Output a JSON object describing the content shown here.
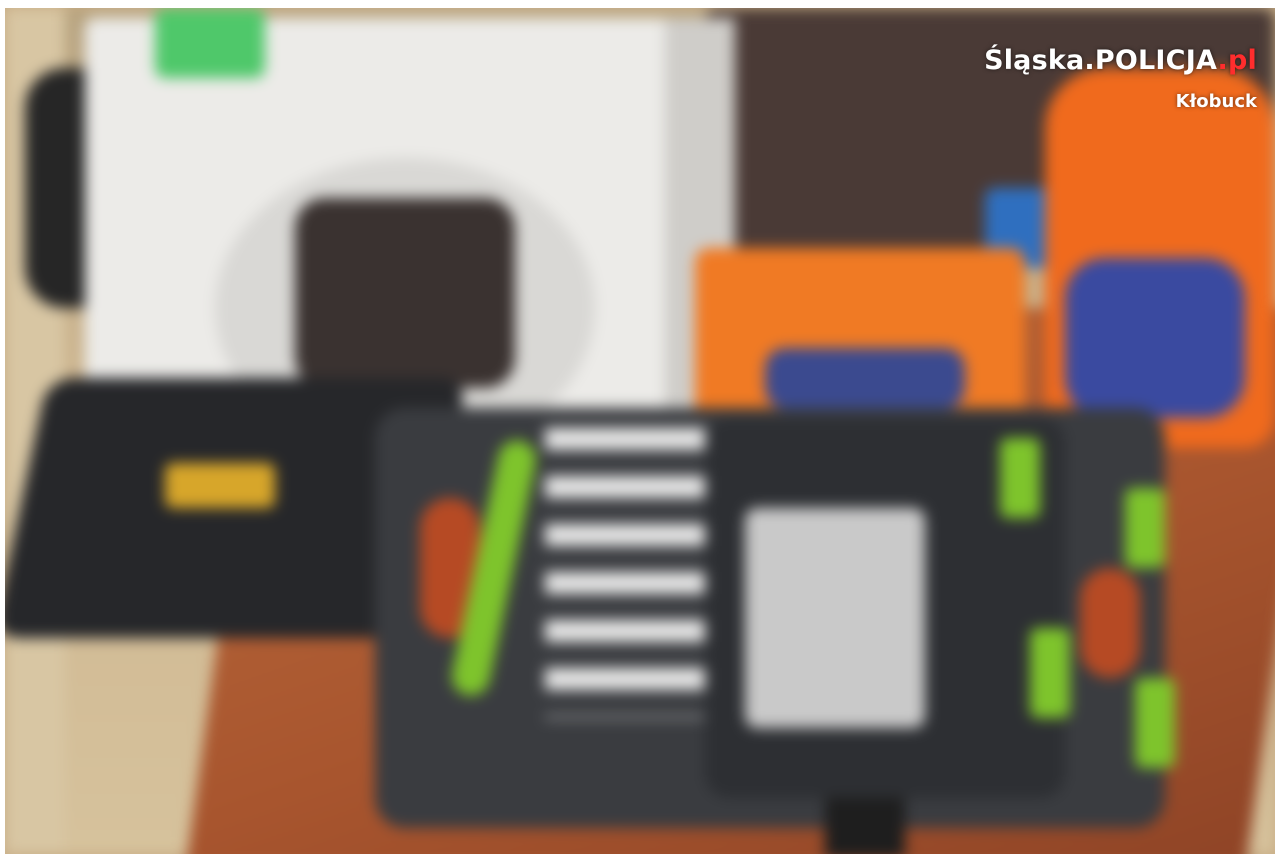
{
  "photo": {
    "subject": "blurred photo of seized items: appliance box, toolbox, socket wrench set, laundry detergent",
    "palette": {
      "floor": "#cdb58f",
      "desk": "#a8552e",
      "box": "#ecebe8",
      "toolcase": "#2f3033",
      "accent_green": "#7ec42c",
      "detergent_orange": "#f06a1d"
    }
  },
  "watermark": {
    "brand_main": "Śląska.POLICJA",
    "brand_suffix": ".pl",
    "unit": "Kłobuck",
    "suffix_color": "#ff2d2d"
  }
}
